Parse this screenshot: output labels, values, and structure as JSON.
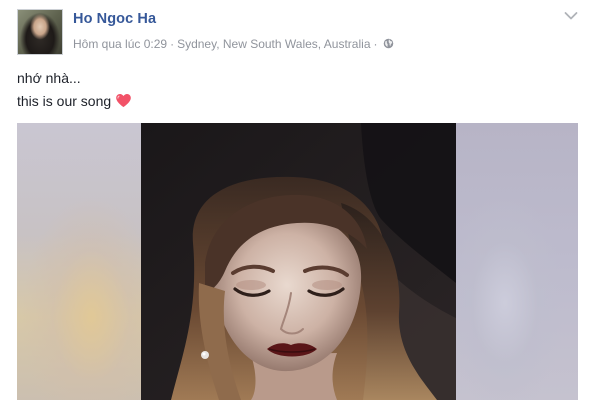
{
  "post": {
    "author": "Ho Ngoc Ha",
    "timestamp": "Hôm qua lúc 0:29",
    "separator_1": "·",
    "location": "Sydney, New South Wales, Australia",
    "separator_2": "·",
    "privacy_icon": "globe-icon",
    "menu_icon": "chevron-down-icon",
    "message_lines": [
      "nhớ nhà...",
      "this is our song"
    ],
    "emoji": "heart-icon"
  },
  "colors": {
    "author_link": "#365899",
    "meta_text": "#90949c",
    "body_text": "#1d2129",
    "heart": "#f25268"
  }
}
